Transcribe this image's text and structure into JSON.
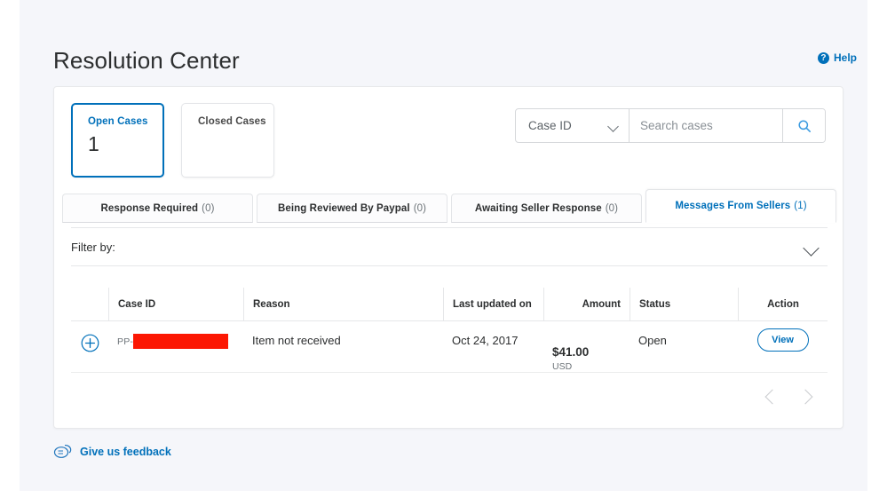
{
  "header": {
    "title": "Resolution Center",
    "help_label": "Help",
    "help_icon": "question-circle-icon",
    "accent_color": "#0070ba"
  },
  "tiles": [
    {
      "label": "Open Cases",
      "count": "1",
      "active": true
    },
    {
      "label": "Closed Cases",
      "count": "",
      "active": false
    }
  ],
  "search": {
    "category_value": "Case ID",
    "placeholder": "Search cases",
    "input_value": "",
    "button_icon": "search-icon"
  },
  "tabs": [
    {
      "label": "Response Required",
      "count": "(0)",
      "active": false
    },
    {
      "label": "Being Reviewed By Paypal",
      "count": "(0)",
      "active": false
    },
    {
      "label": "Awaiting Seller Response",
      "count": "(0)",
      "active": false
    },
    {
      "label": "Messages From Sellers",
      "count": "(1)",
      "active": true
    }
  ],
  "filter": {
    "label": "Filter by:",
    "chevron_icon": "chevron-down-icon"
  },
  "table": {
    "columns": [
      "Case ID",
      "Reason",
      "Last updated on",
      "Amount",
      "Status",
      "Action"
    ],
    "rows": [
      {
        "expand_icon": "plus-circle-icon",
        "case_id_prefix": "PP-",
        "case_id_redacted": true,
        "redaction_color": "#fc1703",
        "reason": "Item not received",
        "last_updated_on": "Oct 24, 2017",
        "amount": "$41.00",
        "currency": "USD",
        "status": "Open",
        "action_label": "View"
      }
    ]
  },
  "pagination": {
    "prev_icon": "chevron-left-icon",
    "next_icon": "chevron-right-icon"
  },
  "feedback": {
    "label": "Give us feedback",
    "icon": "speech-bubble-icon"
  }
}
